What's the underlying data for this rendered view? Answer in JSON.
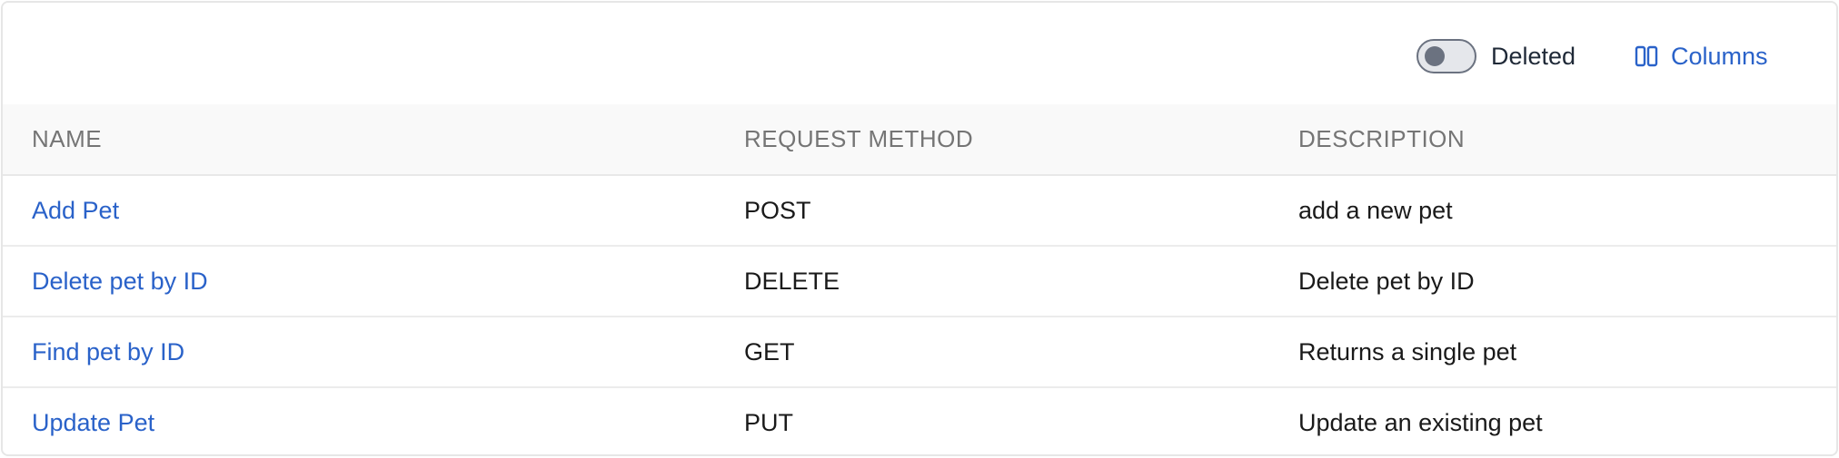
{
  "toolbar": {
    "deleted_label": "Deleted",
    "deleted_on": false,
    "columns_label": "Columns"
  },
  "table": {
    "headers": {
      "name": "NAME",
      "method": "REQUEST METHOD",
      "description": "DESCRIPTION"
    },
    "rows": [
      {
        "name": "Add Pet",
        "method": "POST",
        "description": "add a new pet"
      },
      {
        "name": "Delete pet by ID",
        "method": "DELETE",
        "description": "Delete pet by ID"
      },
      {
        "name": "Find pet by ID",
        "method": "GET",
        "description": "Returns a single pet"
      },
      {
        "name": "Update Pet",
        "method": "PUT",
        "description": "Update an existing pet"
      }
    ]
  },
  "colors": {
    "link": "#2a62c9",
    "header_text": "#757575",
    "header_bg": "#f9f9f9",
    "toggle_off": "#6b7280"
  },
  "icons": {
    "columns": "columns-icon"
  }
}
